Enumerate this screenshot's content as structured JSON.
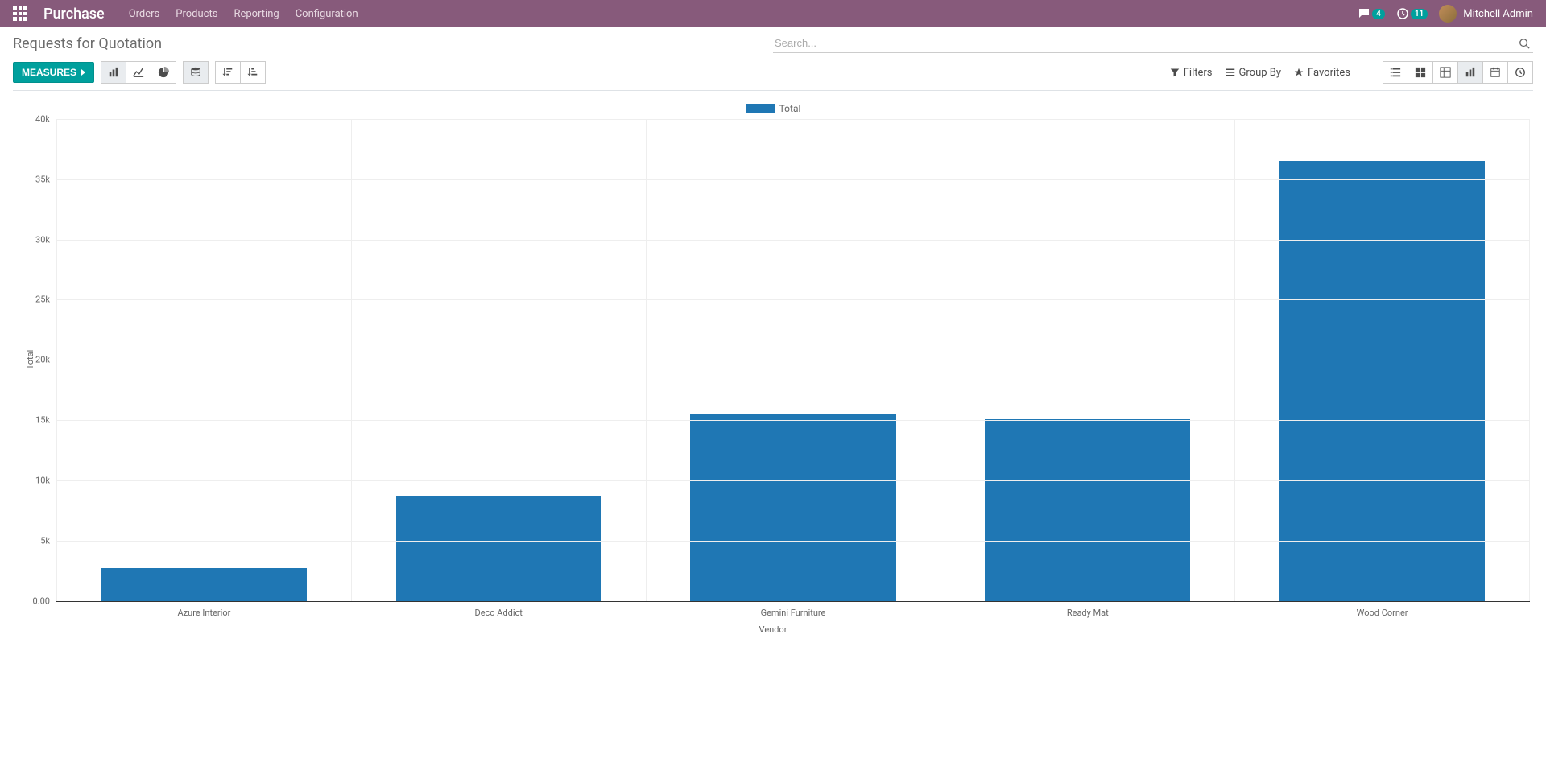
{
  "nav": {
    "app": "Purchase",
    "links": [
      "Orders",
      "Products",
      "Reporting",
      "Configuration"
    ],
    "messages_badge": "4",
    "activities_badge": "11",
    "user": "Mitchell Admin"
  },
  "breadcrumb": "Requests for Quotation",
  "search": {
    "placeholder": "Search..."
  },
  "toolbar": {
    "measures": "MEASURES",
    "filters": "Filters",
    "groupby": "Group By",
    "favorites": "Favorites"
  },
  "chart_data": {
    "type": "bar",
    "title": "",
    "xlabel": "Vendor",
    "ylabel": "Total",
    "ylim": [
      0,
      40000
    ],
    "yticks": [
      "0.00",
      "5k",
      "10k",
      "15k",
      "20k",
      "25k",
      "30k",
      "35k",
      "40k"
    ],
    "legend": "Total",
    "categories": [
      "Azure Interior",
      "Deco Addict",
      "Gemini Furniture",
      "Ready Mat",
      "Wood Corner"
    ],
    "values": [
      2700,
      8700,
      15500,
      15100,
      36500
    ]
  }
}
